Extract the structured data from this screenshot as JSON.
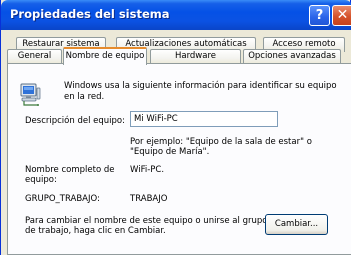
{
  "window": {
    "title": "Propiedades del sistema",
    "help_glyph": "?",
    "close_glyph": "✕"
  },
  "tabs": {
    "row_back": [
      "Restaurar sistema",
      "Actualizaciones automáticas",
      "Acceso remoto"
    ],
    "row_front": [
      "General",
      "Nombre de equipo",
      "Hardware",
      "Opciones avanzadas"
    ],
    "active": "Nombre de equipo"
  },
  "panel": {
    "intro_line1": "Windows usa la siguiente información para identificar su equipo",
    "intro_line2": "en la red.",
    "description_label": "Descripción del equipo:",
    "description_value": "Mi WiFi-PC",
    "example_line1": "Por ejemplo: \"Equipo de la sala de estar\" o",
    "example_line2": "\"Equipo de María\".",
    "full_name_label_line1": "Nombre completo de",
    "full_name_label_line2": "equipo:",
    "full_name_value": "WiFi-PC.",
    "workgroup_label": "GRUPO_TRABAJO:",
    "workgroup_value": "TRABAJO",
    "rename_line1": "Para cambiar el nombre de este equipo o unirse al grupo",
    "rename_line2": "de trabajo, haga clic en Cambiar.",
    "change_button": "Cambiar..."
  },
  "icons": {
    "computer": "computer-network-icon"
  },
  "colors": {
    "title_bar": "#0551e6",
    "active_tab_accent": "#e68b2c",
    "dialog_bg": "#ece9d8",
    "close_button": "#d5532c"
  }
}
